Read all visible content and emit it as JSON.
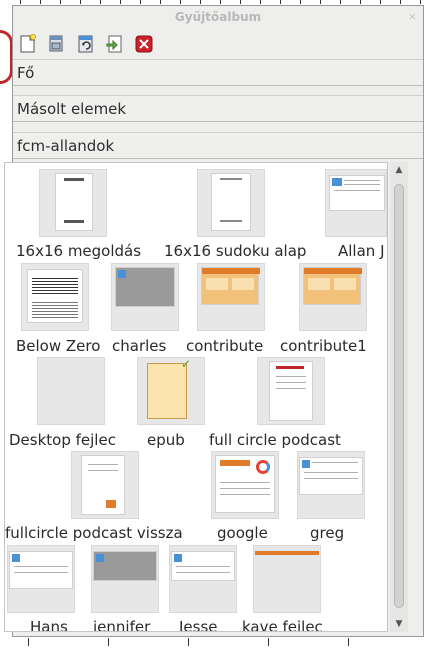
{
  "window": {
    "title": "Gyűjtőalbum",
    "close_glyph": "×"
  },
  "toolbar": {
    "buttons": [
      {
        "name": "new-theme-icon",
        "color": "#f7e36a"
      },
      {
        "name": "open-folder-icon",
        "color": "#6b8fb8"
      },
      {
        "name": "refresh-icon",
        "color": "#4a90d9"
      },
      {
        "name": "export-icon",
        "color": "#6ab04c"
      },
      {
        "name": "delete-icon",
        "color": "#cc2229"
      }
    ]
  },
  "themes": [
    "Fő",
    "Másolt elemek",
    "fcm-allandok"
  ],
  "gallery": {
    "items": [
      {
        "label": "16x16 megoldás"
      },
      {
        "label": "16x16 sudoku alap"
      },
      {
        "label": "Allan J"
      },
      {
        "label": "Below Zero"
      },
      {
        "label": "charles"
      },
      {
        "label": "contribute"
      },
      {
        "label": "contribute1"
      },
      {
        "label": "Desktop fejlec"
      },
      {
        "label": "epub"
      },
      {
        "label": "full circle podcast"
      },
      {
        "label": "fullcircle podcast vissza"
      },
      {
        "label": "google"
      },
      {
        "label": "greg"
      },
      {
        "label": "Hans"
      },
      {
        "label": "jennifer"
      },
      {
        "label": "Jesse"
      },
      {
        "label": "kave fejlec"
      }
    ]
  },
  "colors": {
    "accent": "#4a90d9",
    "red": "#cc2229",
    "orange": "#e07b2a"
  }
}
